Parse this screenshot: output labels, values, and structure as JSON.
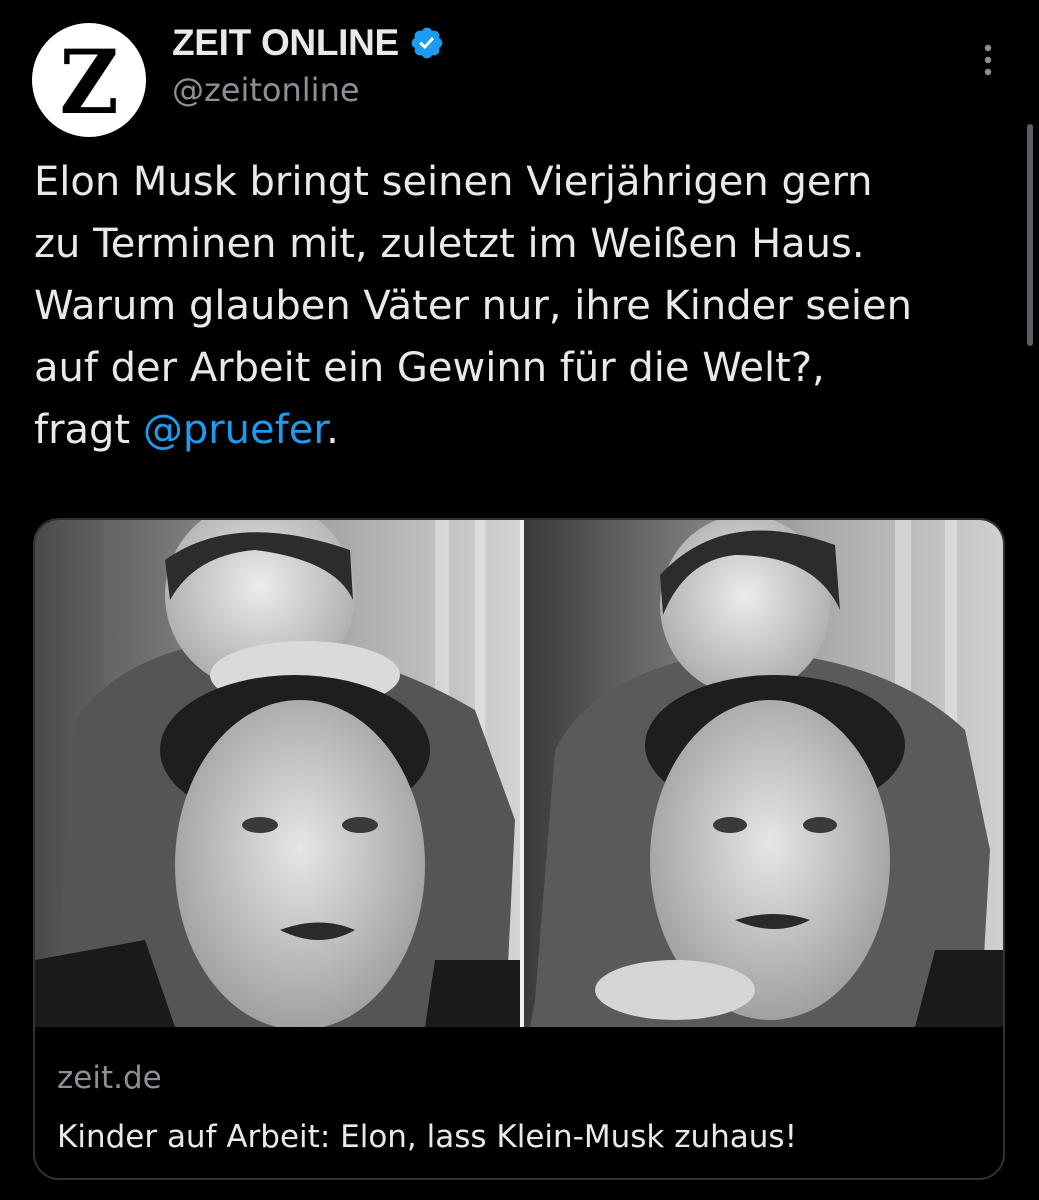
{
  "author": {
    "display_name": "ZEIT ONLINE",
    "handle": "@zeitonline",
    "avatar_letter": "Z",
    "verified_icon": "verified-badge-icon",
    "verified_color": "#1d9bf0"
  },
  "more_icon": "more-vertical-icon",
  "tweet": {
    "text_main": "Elon Musk bringt seinen Vierjährigen gern\nzu Terminen mit, zuletzt im Weißen Haus.\nWarum glauben Väter nur, ihre Kinder seien\nauf der Arbeit ein Gewinn für die Welt?,\nfragt ",
    "mention": "@pruefer",
    "text_end": "."
  },
  "card": {
    "domain": "zeit.de",
    "title": "Kinder auf Arbeit: Elon, lass Klein-Musk zuhaus!"
  },
  "colors": {
    "background": "#000000",
    "text": "#e7e9ea",
    "secondary_text": "#8b9096",
    "link": "#1d9bf0",
    "border": "#2f3336"
  }
}
